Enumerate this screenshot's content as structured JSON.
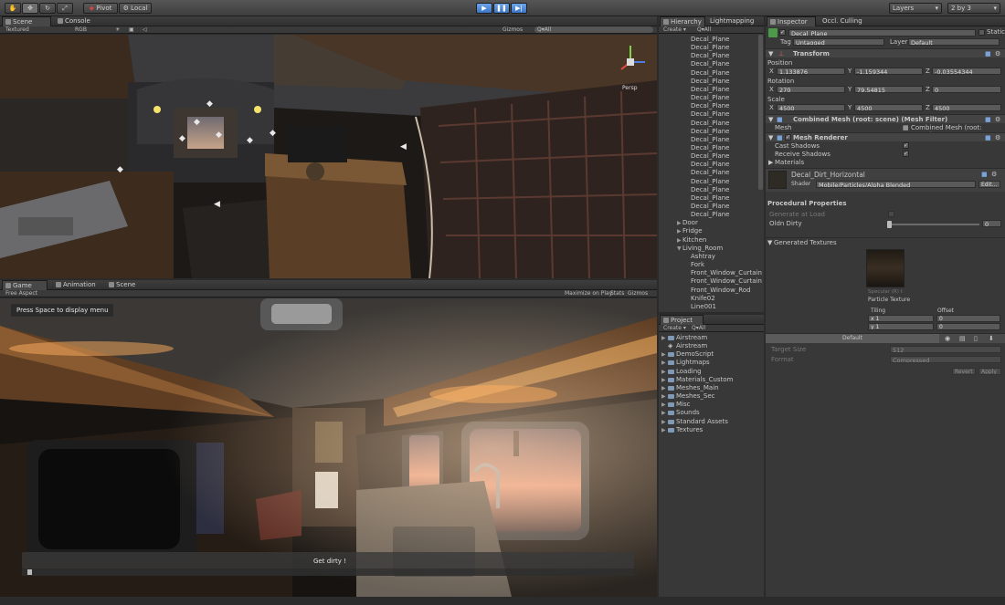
{
  "toolbar": {
    "pivot": "Pivot",
    "local": "Local",
    "layers": "Layers",
    "layout": "2 by 3"
  },
  "scene_panel": {
    "tabs": [
      "Scene",
      "Console"
    ],
    "render_mode": "Textured",
    "color_mode": "RGB",
    "gizmos": "Gizmos",
    "search": "Q▾All",
    "persp": "Persp"
  },
  "game_panel": {
    "tabs": [
      "Game",
      "Animation",
      "Scene"
    ],
    "aspect": "Free Aspect",
    "maximize": "Maximize on Play",
    "stats": "Stats",
    "gizmos": "Gizmos",
    "press_space": "Press Space to display menu",
    "hint": "Get dirty !"
  },
  "hierarchy": {
    "tabs": [
      "Hierarchy",
      "Lightmapping"
    ],
    "create": "Create ▾",
    "search": "Q▾All",
    "decals": [
      "Decal_Plane",
      "Decal_Plane",
      "Decal_Plane",
      "Decal_Plane",
      "Decal_Plane",
      "Decal_Plane",
      "Decal_Plane",
      "Decal_Plane",
      "Decal_Plane",
      "Decal_Plane",
      "Decal_Plane",
      "Decal_Plane",
      "Decal_Plane",
      "Decal_Plane",
      "Decal_Plane",
      "Decal_Plane",
      "Decal_Plane",
      "Decal_Plane",
      "Decal_Plane",
      "Decal_Plane",
      "Decal_Plane",
      "Decal_Plane"
    ],
    "groups": [
      "Door",
      "Fridge",
      "Kitchen",
      "Living_Room"
    ],
    "children": [
      "Ashtray",
      "Fork",
      "Front_Window_Curtain",
      "Front_Window_Curtain",
      "Front_Window_Rod",
      "Knife02",
      "Line001"
    ]
  },
  "project": {
    "tab": "Project",
    "create": "Create ▾",
    "search": "Q▾All",
    "folders": [
      "Airstream",
      "Airstream",
      "DemoScript",
      "Lightmaps",
      "Loading",
      "Materials_Custom",
      "Meshes_Main",
      "Meshes_Sec",
      "Misc",
      "Sounds",
      "Standard Assets",
      "Textures"
    ]
  },
  "inspector": {
    "tabs": [
      "Inspector",
      "Occl. Culling"
    ],
    "object_name": "Decal_Plane",
    "static": "Static",
    "tag_label": "Tag",
    "tag_value": "Untagged",
    "layer_label": "Layer",
    "layer_value": "Default",
    "transform": "Transform",
    "position": "Position",
    "pos_x": "1.133876",
    "pos_y": "-1.159344",
    "pos_z": "-0.03554344",
    "rotation": "Rotation",
    "rot_x": "270",
    "rot_y": "79.54815",
    "rot_z": "0",
    "scale": "Scale",
    "scl_x": "4500",
    "scl_y": "4500",
    "scl_z": "4500",
    "mesh_filter": "Combined Mesh (root: scene) (Mesh Filter)",
    "mesh_label": "Mesh",
    "mesh_value": "Combined Mesh (root: scene)",
    "mesh_renderer": "Mesh Renderer",
    "cast_shadows": "Cast Shadows",
    "receive_shadows": "Receive Shadows",
    "materials": "Materials",
    "material_name": "Decal_Dirt_Horizontal",
    "shader_label": "Shader",
    "shader_value": "Mobile/Particles/Alpha Blended",
    "edit": "Edit...",
    "procedural": "Procedural Properties",
    "generate_at_load": "Generate at Load",
    "oldn_dirty": "Oldn Dirty",
    "oldn_value": "0",
    "generated_textures": "Generated Textures",
    "specular": "Specular (R) t",
    "particle_texture": "Particle Texture",
    "tiling": "Tiling",
    "offset": "Offset",
    "t_x": "x  1",
    "t_y": "y  1",
    "o_x": "0",
    "o_y": "0",
    "default": "Default",
    "target_size": "Target Size",
    "target_value": "512",
    "format": "Format",
    "format_value": "Compressed",
    "revert": "Revert",
    "apply": "Apply"
  }
}
